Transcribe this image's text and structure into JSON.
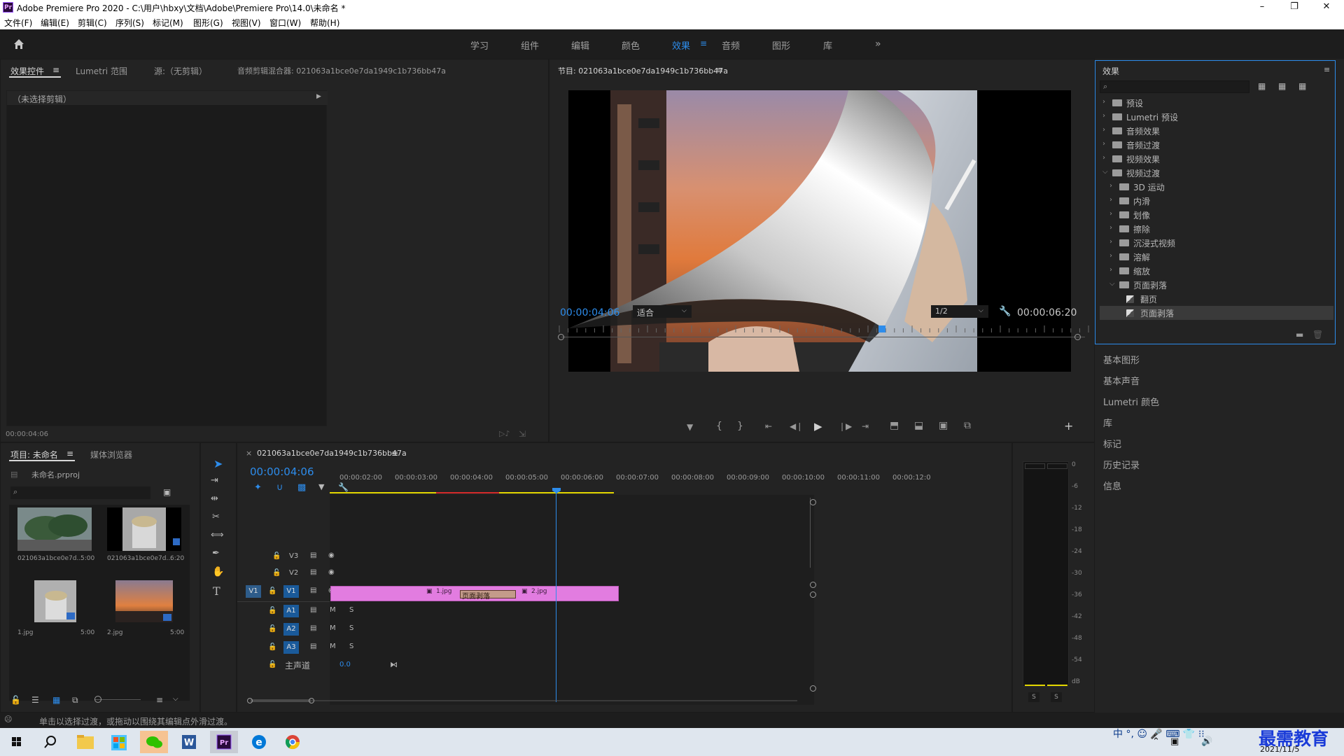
{
  "window": {
    "title": "Adobe Premiere Pro 2020 - C:\\用户\\hbxy\\文档\\Adobe\\Premiere Pro\\14.0\\未命名 *",
    "app_badge": "Pr"
  },
  "menu": [
    "文件(F)",
    "编辑(E)",
    "剪辑(C)",
    "序列(S)",
    "标记(M)",
    "图形(G)",
    "视图(V)",
    "窗口(W)",
    "帮助(H)"
  ],
  "workspaces": [
    "学习",
    "组件",
    "编辑",
    "颜色",
    "效果",
    "音频",
    "图形",
    "库"
  ],
  "active_workspace": "效果",
  "source_panel": {
    "tabs": [
      "效果控件",
      "Lumetri 范围",
      "源:（无剪辑）",
      "音频剪辑混合器: 021063a1bce0e7da1949c1b736bb47a"
    ],
    "no_clip": "（未选择剪辑）",
    "timecode": "00:00:04:06"
  },
  "program": {
    "title": "节目: 021063a1bce0e7da1949c1b736bb47a",
    "timecode": "00:00:04:06",
    "fit": "适合",
    "quality": "1/2",
    "duration": "00:00:06:20",
    "playhead_fraction": 0.616
  },
  "effects": {
    "title": "效果",
    "items": [
      {
        "label": "预设",
        "level": 0,
        "open": false,
        "type": "folder"
      },
      {
        "label": "Lumetri 预设",
        "level": 0,
        "open": false,
        "type": "folder"
      },
      {
        "label": "音频效果",
        "level": 0,
        "open": false,
        "type": "folder"
      },
      {
        "label": "音频过渡",
        "level": 0,
        "open": false,
        "type": "folder"
      },
      {
        "label": "视频效果",
        "level": 0,
        "open": false,
        "type": "folder"
      },
      {
        "label": "视频过渡",
        "level": 0,
        "open": true,
        "type": "folder"
      },
      {
        "label": "3D 运动",
        "level": 1,
        "open": false,
        "type": "folder"
      },
      {
        "label": "内滑",
        "level": 1,
        "open": false,
        "type": "folder"
      },
      {
        "label": "划像",
        "level": 1,
        "open": false,
        "type": "folder"
      },
      {
        "label": "擦除",
        "level": 1,
        "open": false,
        "type": "folder"
      },
      {
        "label": "沉浸式视频",
        "level": 1,
        "open": false,
        "type": "folder"
      },
      {
        "label": "溶解",
        "level": 1,
        "open": false,
        "type": "folder"
      },
      {
        "label": "缩放",
        "level": 1,
        "open": false,
        "type": "folder"
      },
      {
        "label": "页面剥落",
        "level": 1,
        "open": true,
        "type": "folder"
      },
      {
        "label": "翻页",
        "level": 2,
        "open": false,
        "type": "effect"
      },
      {
        "label": "页面剥落",
        "level": 2,
        "open": false,
        "type": "effect",
        "selected": true
      }
    ]
  },
  "side_panels": [
    "基本图形",
    "基本声音",
    "Lumetri 颜色",
    "库",
    "标记",
    "历史记录",
    "信息"
  ],
  "project": {
    "tabs": [
      "项目: 未命名",
      "媒体浏览器"
    ],
    "file": "未命名.prproj",
    "bins": [
      {
        "name": "021063a1bce0e7d...",
        "dur": "5:00"
      },
      {
        "name": "021063a1bce0e7d...",
        "dur": "6:20"
      },
      {
        "name": "1.jpg",
        "dur": "5:00"
      },
      {
        "name": "2.jpg",
        "dur": "5:00"
      }
    ]
  },
  "timeline": {
    "tab": "021063a1bce0e7da1949c1b736bb47a",
    "timecode": "00:00:04:06",
    "ruler": [
      "00:00:02:00",
      "00:00:03:00",
      "00:00:04:00",
      "00:00:05:00",
      "00:00:06:00",
      "00:00:07:00",
      "00:00:08:00",
      "00:00:09:00",
      "00:00:10:00",
      "00:00:11:00",
      "00:00:12:0"
    ],
    "video_tracks": [
      "V3",
      "V2",
      "V1"
    ],
    "audio_tracks": [
      "A1",
      "A2",
      "A3"
    ],
    "source_patch": "V1",
    "master": "主声道",
    "master_value": "0.0",
    "clips": [
      {
        "label": "1.jpg"
      },
      {
        "label": "页面剥落"
      },
      {
        "label": "2.jpg"
      }
    ],
    "ms": [
      "M",
      "S"
    ]
  },
  "meters": {
    "scale": [
      "0",
      "-6",
      "-12",
      "-18",
      "-24",
      "-30",
      "-36",
      "-42",
      "-48",
      "-54",
      "dB"
    ],
    "solo": [
      "S",
      "S"
    ]
  },
  "status": "单击以选择过渡，或拖动以围绕其编辑点外滑过渡。",
  "taskbar": {
    "tray": "中 °, ☺ 🎤 ⌨ 👕 ⁝⁝",
    "date": "2021/11/5",
    "watermark": "最需教育"
  },
  "colors": {
    "accent": "#2d8ceb",
    "clip": "#e27ce0",
    "transition": "#c49b8a",
    "workarea": "#e3d700"
  }
}
